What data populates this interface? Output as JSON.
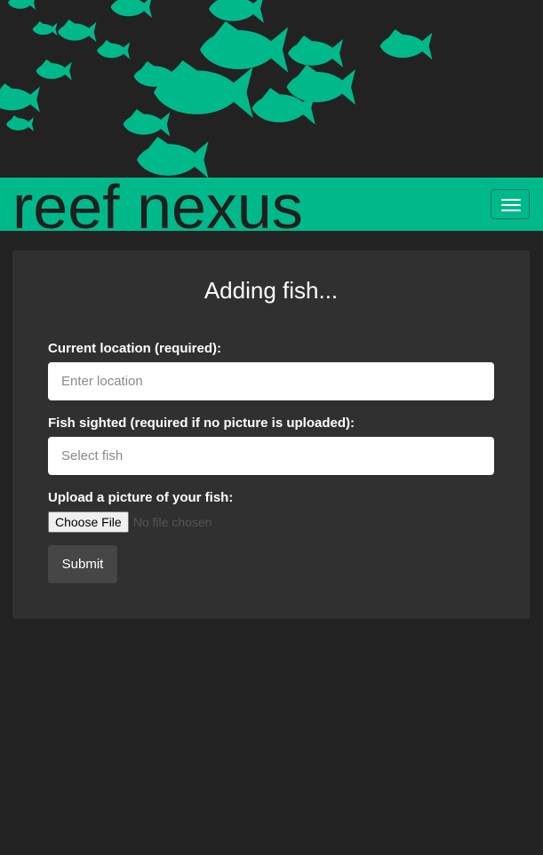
{
  "header": {
    "brand": "reef nexus",
    "menu_icon": "hamburger-menu-icon"
  },
  "banner": {
    "decoration": "fish-school",
    "fish_color": "#00b98b",
    "background_color": "#222222"
  },
  "form": {
    "title": "Adding fish...",
    "location": {
      "label": "Current location (required):",
      "placeholder": "Enter location",
      "value": ""
    },
    "fish": {
      "label": "Fish sighted (required if no picture is uploaded):",
      "placeholder": "Select fish",
      "value": ""
    },
    "picture": {
      "label": "Upload a picture of your fish:",
      "button_label": "Choose File",
      "status": "No file chosen"
    },
    "submit_label": "Submit"
  },
  "colors": {
    "accent": "#00b98b",
    "page_background": "#222222",
    "card_background": "#303030",
    "button_background": "#464646"
  }
}
